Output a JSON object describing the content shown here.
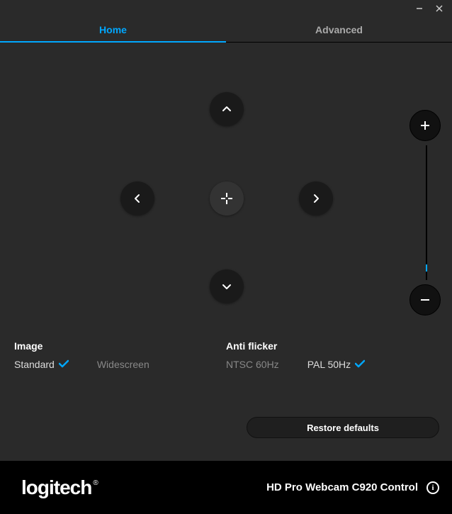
{
  "tabs": {
    "home": "Home",
    "advanced": "Advanced"
  },
  "image": {
    "label": "Image",
    "standard": "Standard",
    "widescreen": "Widescreen",
    "selected": "standard"
  },
  "antiflicker": {
    "label": "Anti flicker",
    "ntsc": "NTSC 60Hz",
    "pal": "PAL 50Hz",
    "selected": "pal"
  },
  "restore_label": "Restore defaults",
  "footer": {
    "brand": "logitech",
    "product": "HD Pro Webcam C920 Control"
  }
}
